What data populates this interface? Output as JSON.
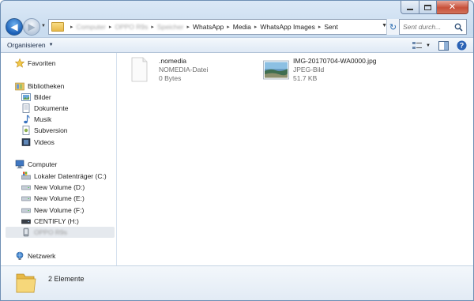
{
  "address": {
    "crumbs": [
      {
        "label": "Computer",
        "blurred": true
      },
      {
        "label": "OPPO R9s",
        "blurred": true
      },
      {
        "label": "Speicher",
        "blurred": true
      },
      {
        "label": "WhatsApp",
        "blurred": false
      },
      {
        "label": "Media",
        "blurred": false
      },
      {
        "label": "WhatsApp Images",
        "blurred": false
      },
      {
        "label": "Sent",
        "blurred": false
      }
    ]
  },
  "search": {
    "placeholder": "Sent durch..."
  },
  "toolbar": {
    "organise_label": "Organisieren"
  },
  "nav": {
    "favorites": "Favoriten",
    "libraries": "Bibliotheken",
    "lib_pictures": "Bilder",
    "lib_documents": "Dokumente",
    "lib_music": "Musik",
    "lib_subversion": "Subversion",
    "lib_videos": "Videos",
    "computer": "Computer",
    "drive_c": "Lokaler Datenträger (C:)",
    "drive_d": "New Volume (D:)",
    "drive_e": "New Volume (E:)",
    "drive_f": "New Volume (F:)",
    "drive_h": "CENTIFLY (H:)",
    "device": "OPPO R9s",
    "network": "Netzwerk"
  },
  "files": [
    {
      "name": ".nomedia",
      "type": "NOMEDIA-Datei",
      "size": "0 Bytes",
      "icon": "blank-file-icon"
    },
    {
      "name": "IMG-20170704-WA0000.jpg",
      "type": "JPEG-Bild",
      "size": "51.7 KB",
      "icon": "image-thumbnail"
    }
  ],
  "details": {
    "count": "2 Elemente"
  },
  "colors": {
    "accent": "#1b5fb6",
    "close": "#c7503a",
    "folder": "#e8b94b"
  }
}
